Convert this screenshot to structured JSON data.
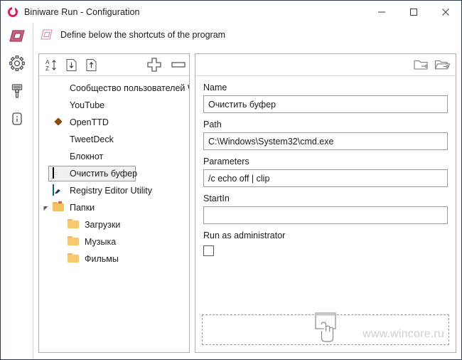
{
  "window": {
    "title": "Biniware Run - Configuration",
    "app_icon": "biniware-logo-icon",
    "minimize_label": "Minimize",
    "maximize_label": "Maximize",
    "close_label": "Close",
    "accent_color": "#e8175d",
    "border_color": "#2b3a55"
  },
  "header": {
    "icon": "parallelogram-outline-icon",
    "label": "Define below the shortcuts of the program"
  },
  "rail": {
    "items": [
      {
        "name": "shortcuts",
        "icon": "parallelogram-filled-icon",
        "active": true
      },
      {
        "name": "settings",
        "icon": "gear-icon",
        "active": false
      },
      {
        "name": "appearance",
        "icon": "brush-icon",
        "active": false
      },
      {
        "name": "about",
        "icon": "info-icon",
        "active": false
      }
    ]
  },
  "tree_toolbar": {
    "buttons": [
      {
        "name": "sort-az",
        "icon": "sort-az-icon",
        "label": "Sort A-Z"
      },
      {
        "name": "import",
        "icon": "import-down-arrow-icon",
        "label": "Import"
      },
      {
        "name": "export",
        "icon": "export-up-arrow-icon",
        "label": "Export"
      },
      {
        "name": "add",
        "icon": "plus-icon",
        "label": "Add"
      },
      {
        "name": "remove",
        "icon": "minus-icon",
        "label": "Remove"
      }
    ]
  },
  "tree": {
    "items": [
      {
        "label": "Сообщество пользователей W",
        "icon": "windows-community-icon",
        "indent": 0,
        "selected": false,
        "expander": ""
      },
      {
        "label": "YouTube",
        "icon": "youtube-icon",
        "indent": 0,
        "selected": false,
        "expander": ""
      },
      {
        "label": "OpenTTD",
        "icon": "openttd-icon",
        "indent": 0,
        "selected": false,
        "expander": ""
      },
      {
        "label": "TweetDeck",
        "icon": "tweetdeck-icon",
        "indent": 0,
        "selected": false,
        "expander": ""
      },
      {
        "label": "Блокнот",
        "icon": "notepad-icon",
        "indent": 0,
        "selected": false,
        "expander": ""
      },
      {
        "label": "Очистить буфер",
        "icon": "cmd-console-icon",
        "indent": 0,
        "selected": true,
        "expander": ""
      },
      {
        "label": "Registry Editor Utility",
        "icon": "registry-editor-icon",
        "indent": 0,
        "selected": false,
        "expander": ""
      },
      {
        "label": "Папки",
        "icon": "folder-open-icon",
        "indent": 0,
        "selected": false,
        "expander": "expanded"
      },
      {
        "label": "Загрузки",
        "icon": "folder-icon",
        "indent": 1,
        "selected": false,
        "expander": ""
      },
      {
        "label": "Музыка",
        "icon": "folder-icon",
        "indent": 1,
        "selected": false,
        "expander": ""
      },
      {
        "label": "Фильмы",
        "icon": "folder-icon",
        "indent": 1,
        "selected": false,
        "expander": ""
      }
    ]
  },
  "detail_toolbar": {
    "buttons": [
      {
        "name": "browse-file",
        "icon": "folder-closed-browse-icon",
        "label": "Browse file"
      },
      {
        "name": "browse-folder",
        "icon": "folder-open-browse-icon",
        "label": "Browse folder"
      }
    ]
  },
  "form": {
    "name_label": "Name",
    "name_value": "Очистить буфер",
    "name_placeholder": "",
    "path_label": "Path",
    "path_value": "C:\\Windows\\System32\\cmd.exe",
    "path_placeholder": "",
    "parameters_label": "Parameters",
    "parameters_value": "/c echo off | clip",
    "parameters_placeholder": "",
    "startin_label": "StartIn",
    "startin_value": "",
    "startin_placeholder": "",
    "run_as_admin_label": "Run as administrator",
    "run_as_admin_checked": false
  },
  "dropzone": {
    "icon": "drag-window-hand-icon",
    "hint": ""
  },
  "watermark": {
    "text": "www.wincore.ru"
  }
}
